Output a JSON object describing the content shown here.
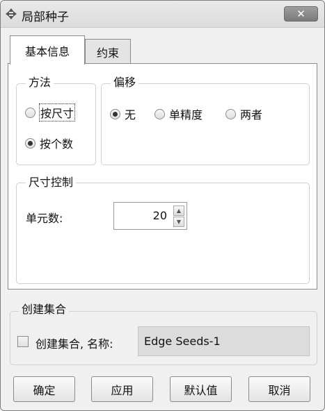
{
  "window": {
    "title": "局部种子",
    "close_glyph": "✕"
  },
  "tabs": [
    {
      "label": "基本信息",
      "active": true
    },
    {
      "label": "约束",
      "active": false
    }
  ],
  "method": {
    "title": "方法",
    "options": [
      {
        "label": "按尺寸",
        "checked": false
      },
      {
        "label": "按个数",
        "checked": true
      }
    ]
  },
  "bias": {
    "title": "偏移",
    "options": [
      {
        "label": "无",
        "checked": true
      },
      {
        "label": "单精度",
        "checked": false
      },
      {
        "label": "两者",
        "checked": false
      }
    ]
  },
  "size_control": {
    "title": "尺寸控制",
    "element_count_label": "单元数:",
    "element_count_value": "20"
  },
  "create_set": {
    "title": "创建集合",
    "checkbox_label": "创建集合, 名称:",
    "checked": false,
    "name_value": "Edge Seeds-1"
  },
  "buttons": {
    "ok": "确定",
    "apply": "应用",
    "defaults": "默认值",
    "cancel": "取消"
  }
}
